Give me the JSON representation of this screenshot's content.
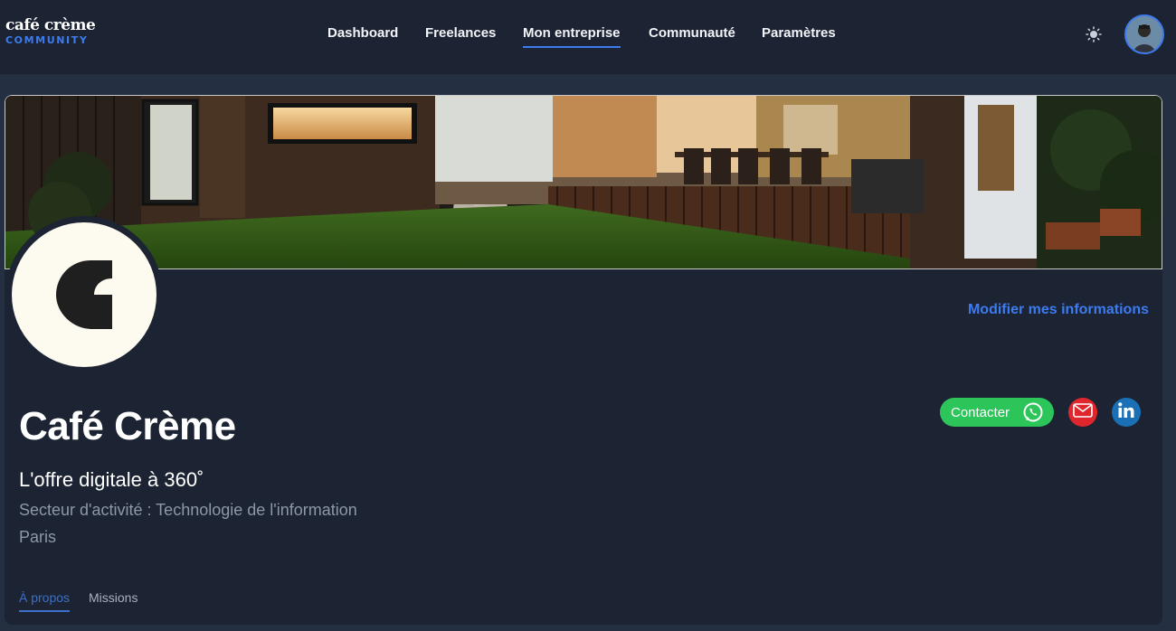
{
  "brand": {
    "line1": "café crème",
    "line2": "COMMUNITY"
  },
  "nav": {
    "items": [
      {
        "label": "Dashboard"
      },
      {
        "label": "Freelances"
      },
      {
        "label": "Mon entreprise"
      },
      {
        "label": "Communauté"
      },
      {
        "label": "Paramètres"
      }
    ],
    "active": "Mon entreprise"
  },
  "header_icons": {
    "theme_toggle": "sun-icon",
    "avatar": "user-avatar"
  },
  "profile": {
    "edit_link": "Modifier mes informations",
    "company_name": "Café Crème",
    "tagline": "L'offre digitale à 360˚",
    "sector": "Secteur d'activité : Technologie de l'information",
    "city": "Paris"
  },
  "actions": {
    "contact_label": "Contacter",
    "contact_icon": "whatsapp-icon",
    "email_icon": "mail-icon",
    "linkedin_icon": "linkedin-icon"
  },
  "tabs": [
    {
      "label": "À propos",
      "active": true
    },
    {
      "label": "Missions",
      "active": false
    }
  ],
  "colors": {
    "accent": "#3d7bf0",
    "background": "#243041",
    "surface": "#1c2433",
    "whatsapp_green": "#2cc55a",
    "mail_red": "#e0262d",
    "linkedin_blue": "#1a6fb5"
  }
}
